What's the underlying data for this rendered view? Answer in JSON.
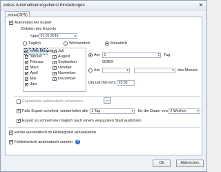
{
  "window": {
    "title": "extras Automatisierungsdienst Einstellungen",
    "close_glyph": "✕"
  },
  "tab": {
    "label": "extras(GPN)"
  },
  "auto_export": {
    "label": "Automatischer Export",
    "checked": true
  },
  "schedule": {
    "heading": "Zeitplan des Exports",
    "start_label": "Start",
    "start_value": "01.01.2019",
    "frequency": [
      {
        "label": "Täglich",
        "selected": false
      },
      {
        "label": "Wöchentlich",
        "selected": false
      },
      {
        "label": "Monatlich",
        "selected": true
      }
    ],
    "months_col1": [
      {
        "label": "<Alle Monate>",
        "checked": true,
        "selected": true
      },
      {
        "label": "Januar",
        "checked": true
      },
      {
        "label": "Februar",
        "checked": true
      },
      {
        "label": "März",
        "checked": true
      },
      {
        "label": "April",
        "checked": true
      },
      {
        "label": "Mai",
        "checked": true
      },
      {
        "label": "Juni",
        "checked": true
      }
    ],
    "months_col2": [
      {
        "label": "Juli",
        "checked": true
      },
      {
        "label": "August",
        "checked": true
      },
      {
        "label": "September",
        "checked": true
      },
      {
        "label": "Oktober",
        "checked": true
      },
      {
        "label": "November",
        "checked": true
      },
      {
        "label": "Dezember",
        "checked": true
      }
    ],
    "am_label": "Am",
    "day_value": "1",
    "tag_label": "Tag",
    "oder_label": "ODER",
    "am2_label": "Am",
    "des_monats_label": "des Monats",
    "time_label": "Uhrzeit [hh:mm]",
    "time_value": "23:00"
  },
  "options": {
    "export_send": {
      "label": "Exportdatei automatisch versenden",
      "checked": false
    },
    "retry": {
      "label": "Falls Export scheitert, wiederholen alle",
      "checked": true,
      "interval_value": "1 Tag",
      "duration_label": "für die Dauer von",
      "duration_value": "2 Wochen"
    },
    "catch_up": {
      "label": "Export so schnell wie möglich nach einem verpassten Start ausführen",
      "checked": true
    }
  },
  "background_update": {
    "label": "extras automatisch im Hintergrund aktualisieren",
    "checked": true
  },
  "error_report": {
    "label": "Fehlerbericht automatisch senden",
    "checked": true,
    "info_icon": "help-icon"
  },
  "buttons": {
    "ok": "Ok",
    "cancel": "Abbrechen"
  }
}
